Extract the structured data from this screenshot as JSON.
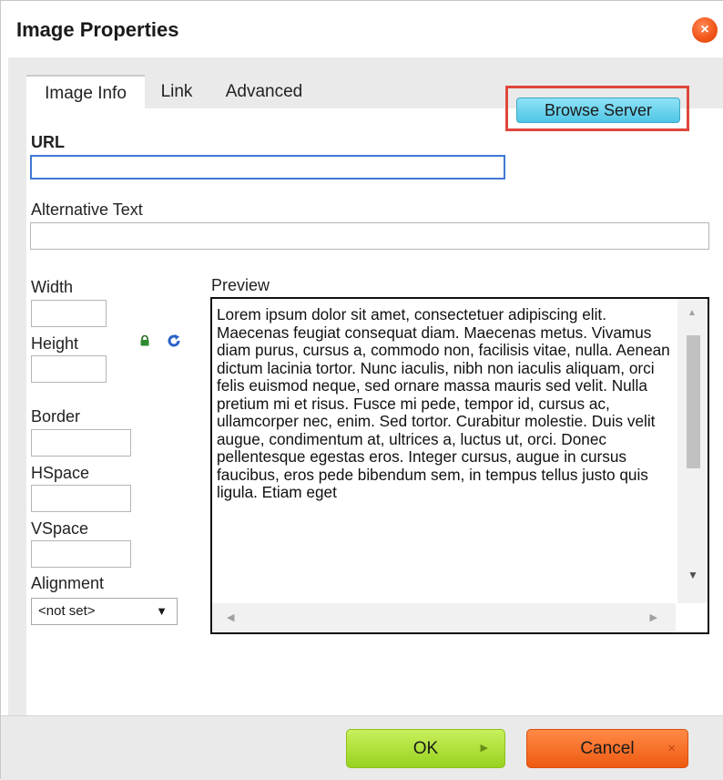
{
  "dialog": {
    "title": "Image Properties",
    "close_symbol": "×",
    "close_color": "#f2561a"
  },
  "tabs": [
    {
      "label": "Image Info",
      "active": true
    },
    {
      "label": "Link",
      "active": false
    },
    {
      "label": "Advanced",
      "active": false
    }
  ],
  "url": {
    "label": "URL",
    "value": ""
  },
  "browse": {
    "label": "Browse Server",
    "highlight_color": "#e0473c"
  },
  "alt_text": {
    "label": "Alternative Text",
    "value": ""
  },
  "width": {
    "label": "Width",
    "value": ""
  },
  "height": {
    "label": "Height",
    "value": ""
  },
  "lock_icon": "lock-icon",
  "reset_icon": "reset-size-icon",
  "border": {
    "label": "Border",
    "value": ""
  },
  "hspace": {
    "label": "HSpace",
    "value": ""
  },
  "vspace": {
    "label": "VSpace",
    "value": ""
  },
  "alignment": {
    "label": "Alignment",
    "selected": "<not set>",
    "arrow": "▼"
  },
  "preview": {
    "label": "Preview",
    "text": "Lorem ipsum dolor sit amet, consectetuer adipiscing elit. Maecenas feugiat consequat diam. Maecenas metus. Vivamus diam purus, cursus a, commodo non, facilisis vitae, nulla. Aenean dictum lacinia tortor. Nunc iaculis, nibh non iaculis aliquam, orci felis euismod neque, sed ornare massa mauris sed velit. Nulla pretium mi et risus. Fusce mi pede, tempor id, cursus ac, ullamcorper nec, enim. Sed tortor. Curabitur molestie. Duis velit augue, condimentum at, ultrices a, luctus ut, orci. Donec pellentesque egestas eros. Integer cursus, augue in cursus faucibus, eros pede bibendum sem, in tempus tellus justo quis ligula. Etiam eget"
  },
  "footer": {
    "ok_label": "OK",
    "ok_deco": "▶",
    "cancel_label": "Cancel",
    "cancel_deco": "×",
    "ok_color": "#98d21e",
    "cancel_color": "#ef5a12"
  }
}
